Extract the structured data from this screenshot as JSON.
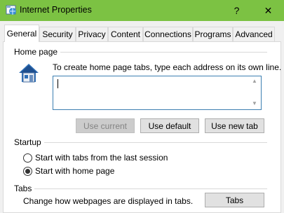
{
  "window": {
    "title": "Internet Properties",
    "help_glyph": "?",
    "close_glyph": "✕",
    "accent_color": "#7cc243"
  },
  "tabs": [
    {
      "label": "General",
      "active": true
    },
    {
      "label": "Security",
      "active": false
    },
    {
      "label": "Privacy",
      "active": false
    },
    {
      "label": "Content",
      "active": false
    },
    {
      "label": "Connections",
      "active": false
    },
    {
      "label": "Programs",
      "active": false
    },
    {
      "label": "Advanced",
      "active": false
    }
  ],
  "home_page": {
    "group_label": "Home page",
    "instruction": "To create home page tabs, type each address on its own line.",
    "value": "",
    "icon": "house-icon",
    "buttons": {
      "use_current": "Use current",
      "use_default": "Use default",
      "use_new_tab": "Use new tab"
    },
    "use_current_disabled": true
  },
  "startup": {
    "group_label": "Startup",
    "options": [
      {
        "label": "Start with tabs from the last session",
        "checked": false
      },
      {
        "label": "Start with home page",
        "checked": true
      }
    ]
  },
  "tabs_section": {
    "group_label": "Tabs",
    "description": "Change how webpages are displayed in tabs.",
    "button": "Tabs"
  }
}
